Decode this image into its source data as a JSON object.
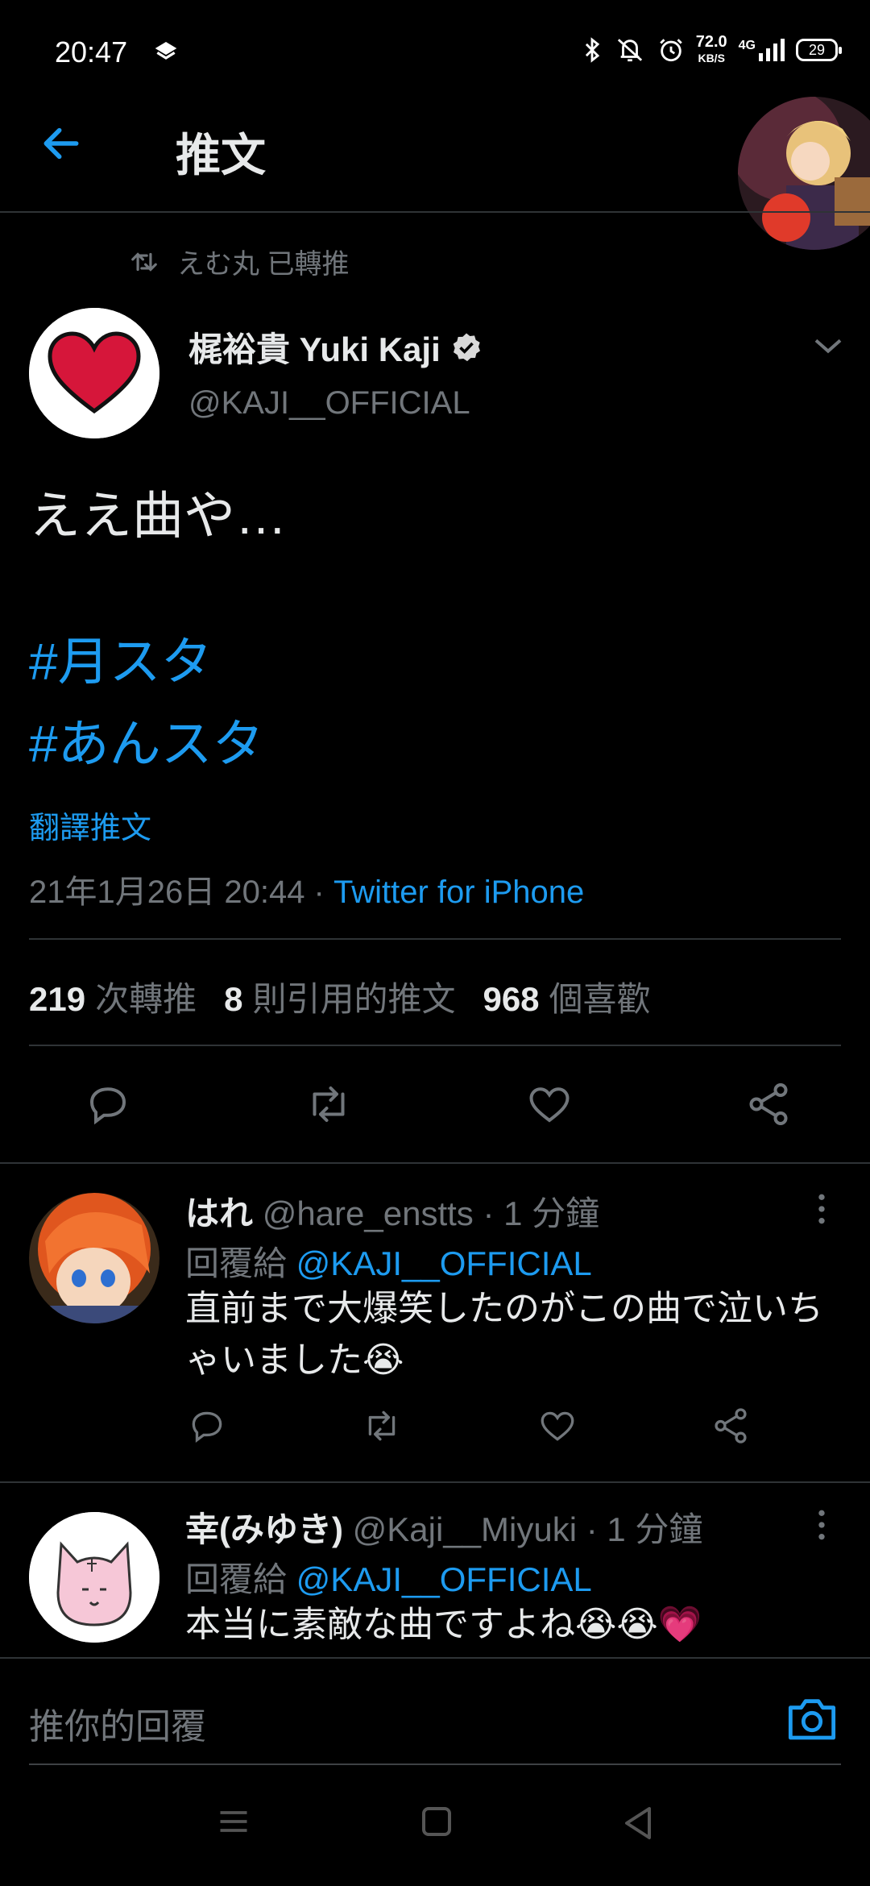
{
  "status_bar": {
    "time": "20:47",
    "net_speed": "72.0",
    "net_unit": "KB/S",
    "network": "4G",
    "battery": "29"
  },
  "header": {
    "title": "推文"
  },
  "tweet": {
    "retweet_context": "えむ丸 已轉推",
    "author_name": "梶裕貴 Yuki Kaji",
    "author_handle": "@KAJI__OFFICIAL",
    "text": "ええ曲や…",
    "hashtags": [
      "#月スタ",
      "#あんスタ"
    ],
    "translate_label": "翻譯推文",
    "timestamp": "21年1月26日 20:44 · ",
    "source": "Twitter for iPhone",
    "stats": {
      "retweets_count": "219",
      "retweets_label": "次轉推",
      "quotes_count": "8",
      "quotes_label": "則引用的推文",
      "likes_count": "968",
      "likes_label": "個喜歡"
    }
  },
  "replies": [
    {
      "name": "はれ",
      "handle": "@hare_enstts",
      "time": " · 1 分鐘",
      "reply_to_label": "回覆給 ",
      "reply_to_handle": "@KAJI__OFFICIAL",
      "text": "直前まで大爆笑したのがこの曲で泣いちゃいました😭"
    },
    {
      "name": "幸(みゆき)",
      "handle": "@Kaji__Miyuki",
      "time": " · 1 分鐘",
      "reply_to_label": "回覆給 ",
      "reply_to_handle": "@KAJI__OFFICIAL",
      "text": "本当に素敵な曲ですよね😭😭💗"
    }
  ],
  "composer": {
    "placeholder": "推你的回覆"
  },
  "colors": {
    "accent": "#1d9bf0",
    "background": "#000000",
    "secondary_text": "#71767b",
    "heart_red": "#d6163a"
  },
  "icons": [
    "back-arrow-icon",
    "retweet-icon",
    "verified-icon",
    "chevron-down-icon",
    "reply-icon",
    "like-icon",
    "share-icon",
    "more-icon",
    "camera-icon"
  ]
}
